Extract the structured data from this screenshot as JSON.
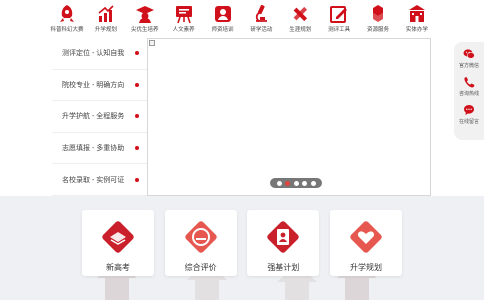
{
  "nav": {
    "items": [
      {
        "label": "科普科幻大赛",
        "icon": "rocket-icon"
      },
      {
        "label": "升学规划",
        "icon": "growth-chart-icon"
      },
      {
        "label": "尖优生培养",
        "icon": "graduate-cap-icon"
      },
      {
        "label": "人文素养",
        "icon": "easel-board-icon"
      },
      {
        "label": "师资培训",
        "icon": "teacher-icon"
      },
      {
        "label": "研学活动",
        "icon": "microscope-icon"
      },
      {
        "label": "生涯规划",
        "icon": "pencil-ruler-icon"
      },
      {
        "label": "测评工具",
        "icon": "edit-form-icon"
      },
      {
        "label": "资源服务",
        "icon": "cubes-icon"
      },
      {
        "label": "实体办学",
        "icon": "school-building-icon"
      }
    ]
  },
  "menu": {
    "items": [
      {
        "label": "测评定位 - 认知自我"
      },
      {
        "label": "院校专业 - 明确方向"
      },
      {
        "label": "升学护航 - 全程服务"
      },
      {
        "label": "志愿填报 - 多重协助"
      },
      {
        "label": "名校录取 - 实例可证"
      }
    ]
  },
  "banner": {
    "pages": 5,
    "active_page": 2
  },
  "sidebar": {
    "items": [
      {
        "label": "官方微信",
        "icon": "wechat-icon"
      },
      {
        "label": "咨询热线",
        "icon": "phone-icon"
      },
      {
        "label": "在线留言",
        "icon": "chat-bubble-icon"
      }
    ]
  },
  "cards": {
    "items": [
      {
        "label": "新高考",
        "icon": "gaokao-diamond-icon"
      },
      {
        "label": "综合评价",
        "icon": "evaluation-icon"
      },
      {
        "label": "强基计划",
        "icon": "id-card-icon"
      },
      {
        "label": "升学规划",
        "icon": "planning-heart-icon"
      }
    ]
  },
  "colors": {
    "brand_red": "#d0111b",
    "pager_active": "#e0443c",
    "bottom_bg": "#eef0f3"
  }
}
